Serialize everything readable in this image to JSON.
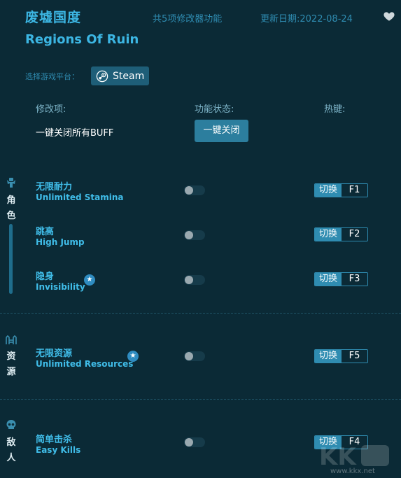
{
  "header": {
    "title_cn": "废墟国度",
    "title_en": "Regions Of Ruin",
    "features_count": "共5项修改器功能",
    "update_date": "更新日期:2022-08-24",
    "favorite_icon": "heart-icon"
  },
  "platform": {
    "label": "选择游戏平台：",
    "button_label": "Steam",
    "icon": "steam-icon"
  },
  "columns": {
    "modifier": "修改项:",
    "status": "功能状态:",
    "hotkey": "热键:"
  },
  "global": {
    "buff_label": "一键关闭所有BUFF",
    "close_all_button": "一键关闭"
  },
  "categories": [
    {
      "icon": "character-icon",
      "chars": [
        "角",
        "色"
      ]
    },
    {
      "icon": "resources-icon",
      "chars": [
        "资",
        "源"
      ]
    },
    {
      "icon": "skull-icon",
      "chars": [
        "敌",
        "人"
      ]
    }
  ],
  "rows": [
    {
      "name_cn": "无限耐力",
      "name_en": "Unlimited Stamina",
      "starred": false,
      "enabled": false,
      "hotkey_switch": "切换",
      "hotkey_key": "F1"
    },
    {
      "name_cn": "跳高",
      "name_en": "High Jump",
      "starred": false,
      "enabled": false,
      "hotkey_switch": "切换",
      "hotkey_key": "F2"
    },
    {
      "name_cn": "隐身",
      "name_en": "Invisibility",
      "starred": true,
      "enabled": false,
      "hotkey_switch": "切换",
      "hotkey_key": "F3"
    },
    {
      "name_cn": "无限资源",
      "name_en": "Unlimited Resources",
      "starred": true,
      "enabled": false,
      "hotkey_switch": "切换",
      "hotkey_key": "F5"
    },
    {
      "name_cn": "简单击杀",
      "name_en": "Easy Kills",
      "starred": false,
      "enabled": false,
      "hotkey_switch": "切换",
      "hotkey_key": "F4"
    }
  ],
  "watermark": {
    "url": "www.kkx.net"
  },
  "colors": {
    "background": "#0b2a36",
    "accent": "#3cb6e3",
    "button": "#2c7e9e",
    "hotkey_border": "#2f8cb1"
  }
}
